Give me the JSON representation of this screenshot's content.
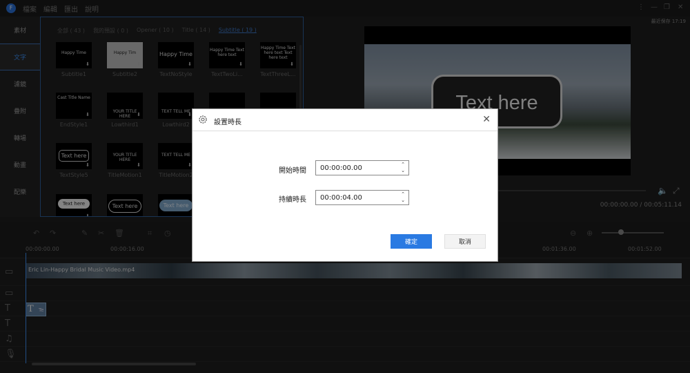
{
  "menubar": {
    "logo": "F",
    "items": [
      "檔案",
      "編輯",
      "匯出",
      "說明"
    ],
    "window_controls": [
      "⋮",
      "—",
      "❐",
      "✕"
    ]
  },
  "sidebar": {
    "items": [
      {
        "label": "素材"
      },
      {
        "label": "文字"
      },
      {
        "label": "濾鏡"
      },
      {
        "label": "疊附"
      },
      {
        "label": "轉場"
      },
      {
        "label": "動畫"
      },
      {
        "label": "配樂"
      }
    ],
    "active_index": 1
  },
  "library": {
    "filters": [
      "全部 ( 43 )",
      "我的預設 ( 0 )",
      "Opener ( 10 )",
      "Title ( 14 )",
      "Subtitle ( 19 )"
    ],
    "selected_filter": "Subtitle ( 19 )",
    "tiles": [
      {
        "name": "Subtitle1",
        "thumb_text": "Happy Time"
      },
      {
        "name": "Subtitle2",
        "thumb_text": "Happy Tim"
      },
      {
        "name": "TextNoStyle",
        "thumb_text": "Happy Time"
      },
      {
        "name": "TextTwoLi...",
        "thumb_text": "Happy Time Text here text"
      },
      {
        "name": "TextThreeL...",
        "thumb_text": "Happy Time Text here text Text here text"
      },
      {
        "name": "EndStyle1",
        "thumb_text": "Cast Title Name"
      },
      {
        "name": "Lowthird1",
        "thumb_text": "YOUR TITLE HERE"
      },
      {
        "name": "Lowthird2",
        "thumb_text": "TEXT TELL ME"
      },
      {
        "name": "",
        "thumb_text": ""
      },
      {
        "name": "",
        "thumb_text": ""
      },
      {
        "name": "TextStyle5",
        "thumb_text": "Text here"
      },
      {
        "name": "TitleMotion1",
        "thumb_text": "YOUR TITLE HERE"
      },
      {
        "name": "TitleMotion2",
        "thumb_text": "TEXT TELL ME"
      },
      {
        "name": "",
        "thumb_text": "Text here"
      },
      {
        "name": "",
        "thumb_text": "Text here"
      },
      {
        "name": "",
        "thumb_text": "Text here"
      }
    ]
  },
  "preview": {
    "autosave": "最近保存 17:19",
    "bubble_text": "Text here",
    "timecode": "00:00:00.00 / 00:05:11.14"
  },
  "timeline": {
    "ruler": [
      "00:00:00.00",
      "00:00:16.00",
      "00:01:36.00",
      "00:01:52.00"
    ],
    "video_clip_name": "Eric Lin-Happy Bridal Music Video.mp4",
    "text_clip_label": "T",
    "text_clip_sub": "Te"
  },
  "dialog": {
    "title": "設置時長",
    "start_label": "開始時間",
    "start_value": "00:00:00.00",
    "duration_label": "持續時長",
    "duration_value": "00:00:04.00",
    "ok_label": "確定",
    "cancel_label": "取消"
  },
  "colors": {
    "accent": "#2a7ae2",
    "panel_border": "#2f5f9c"
  }
}
